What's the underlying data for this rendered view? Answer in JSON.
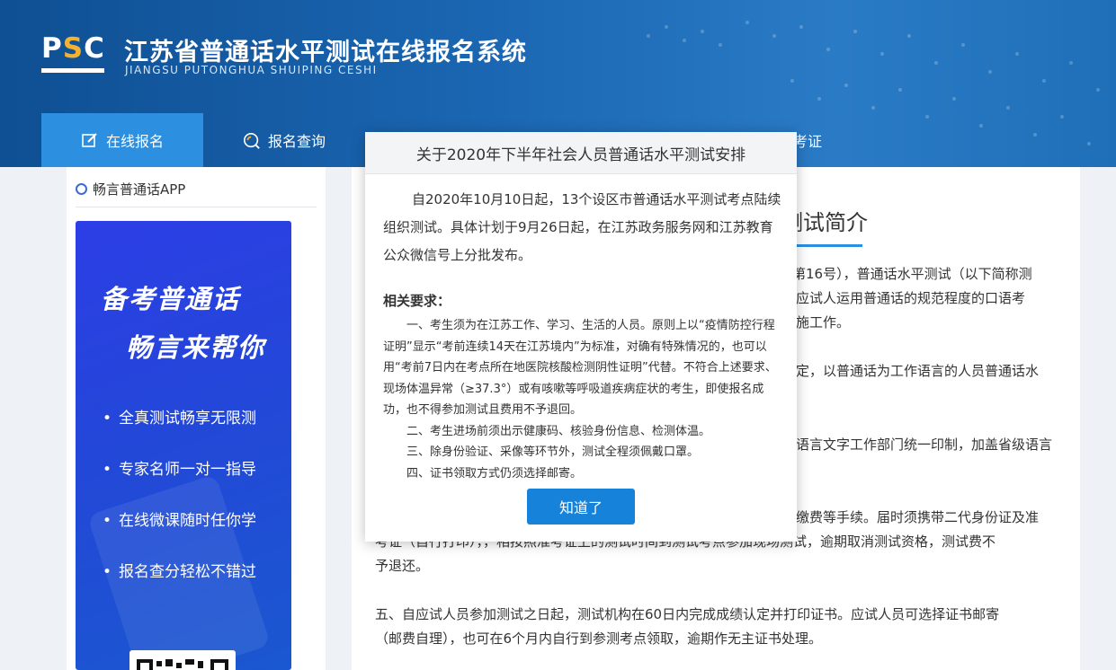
{
  "header": {
    "logo_text_p": "P",
    "logo_text_s": "S",
    "logo_text_c": "C",
    "title": "江苏省普通话水平测试在线报名系统",
    "subtitle": "JIANGSU PUTONGHUA SHUIPING CESHI",
    "brand_color": "#1b67b3"
  },
  "nav": {
    "items": [
      {
        "label": "在线报名",
        "icon": "edit-icon",
        "active": true
      },
      {
        "label": "报名查询",
        "icon": "search-icon",
        "active": false
      },
      {
        "label": "考证",
        "icon": "",
        "active": false
      }
    ]
  },
  "sidebar": {
    "app_title": "畅言普通话APP",
    "promo": {
      "line1": "备考普通话",
      "line2": "畅言来帮你",
      "features": [
        "全真测试畅享无限测",
        "专家名师一对一指导",
        "在线微课随时任你学",
        "报名查分轻松不错过"
      ]
    }
  },
  "main": {
    "title": "测试简介",
    "paragraphs": [
      {
        "text": "第16号），普通话水平测试（以下简称测"
      },
      {
        "text": "应试人运用普通话的规范程度的口语考"
      },
      {
        "text": "施工作。"
      },
      {
        "text": "定，以普通话为工作语言的人员普通话水"
      },
      {
        "text": "语言文字工作部门统一印制，加盖省级语言"
      },
      {
        "text": "缴费等手续。届时须携带二代身份证及准"
      },
      {
        "text": "考证（自行打印），，相按照准考证上的测试时间到测试考点参加现场测试，逾期取消测试资格，测试费不"
      },
      {
        "text": "予退还。"
      },
      {
        "text": "五、自应试人员参加测试之日起，测试机构在60日内完成成绩认定并打印证书。应试人员可选择证书邮寄"
      },
      {
        "text": "（邮费自理），也可在6个月内自行到参测考点领取，逾期作无主证书处理。"
      }
    ]
  },
  "modal": {
    "title": "关于2020年下半年社会人员普通话水平测试安排",
    "intro": "自2020年10月10日起，13个设区市普通话水平测试考点陆续组织测试。具体计划于9月26日起，在江苏政务服务网和江苏教育公众微信号上分批发布。",
    "req_title": "相关要求：",
    "items": [
      "一、考生须为在江苏工作、学习、生活的人员。原则上以“疫情防控行程证明”显示“考前连续14天在江苏境内”为标准，对确有特殊情况的，也可以用“考前7日内在考点所在地医院核酸检测阴性证明”代替。不符合上述要求、现场体温异常（≥37.3°）或有咳嗽等呼吸道疾病症状的考生，即使报名成功，也不得参加测试且费用不予退回。",
      "二、考生进场前须出示健康码、核验身份信息、检测体温。",
      "三、除身份验证、采像等环节外，测试全程须佩戴口罩。",
      "四、证书领取方式仍须选择邮寄。"
    ],
    "button_label": "知道了",
    "button_color": "#1782d9"
  }
}
